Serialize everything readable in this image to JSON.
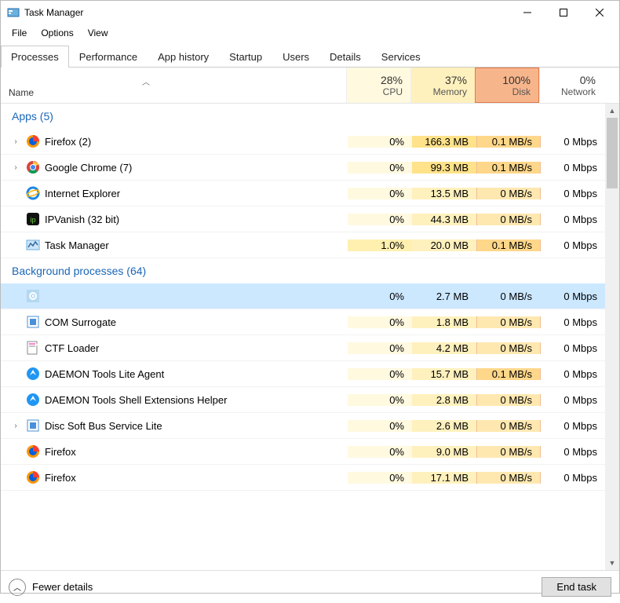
{
  "window": {
    "title": "Task Manager"
  },
  "menu": {
    "file": "File",
    "options": "Options",
    "view": "View"
  },
  "tabs": {
    "processes": "Processes",
    "performance": "Performance",
    "apphistory": "App history",
    "startup": "Startup",
    "users": "Users",
    "details": "Details",
    "services": "Services"
  },
  "columns": {
    "name": "Name",
    "cpu": {
      "pct": "28%",
      "label": "CPU"
    },
    "mem": {
      "pct": "37%",
      "label": "Memory"
    },
    "dsk": {
      "pct": "100%",
      "label": "Disk"
    },
    "net": {
      "pct": "0%",
      "label": "Network"
    }
  },
  "groups": {
    "apps": "Apps (5)",
    "bg": "Background processes (64)"
  },
  "apps": [
    {
      "exp": true,
      "icon": "firefox",
      "name": "Firefox (2)",
      "cpu": "0%",
      "mem": "166.3 MB",
      "dsk": "0.1 MB/s",
      "net": "0 Mbps"
    },
    {
      "exp": true,
      "icon": "chrome",
      "name": "Google Chrome (7)",
      "cpu": "0%",
      "mem": "99.3 MB",
      "dsk": "0.1 MB/s",
      "net": "0 Mbps"
    },
    {
      "exp": false,
      "icon": "ie",
      "name": "Internet Explorer",
      "cpu": "0%",
      "mem": "13.5 MB",
      "dsk": "0 MB/s",
      "net": "0 Mbps"
    },
    {
      "exp": false,
      "icon": "ipv",
      "name": "IPVanish (32 bit)",
      "cpu": "0%",
      "mem": "44.3 MB",
      "dsk": "0 MB/s",
      "net": "0 Mbps"
    },
    {
      "exp": false,
      "icon": "tm",
      "name": "Task Manager",
      "cpu": "1.0%",
      "mem": "20.0 MB",
      "dsk": "0.1 MB/s",
      "net": "0 Mbps"
    }
  ],
  "bg": [
    {
      "exp": false,
      "icon": "gear",
      "name": "",
      "cpu": "0%",
      "mem": "2.7 MB",
      "dsk": "0 MB/s",
      "net": "0 Mbps",
      "selected": true
    },
    {
      "exp": false,
      "icon": "com",
      "name": "COM Surrogate",
      "cpu": "0%",
      "mem": "1.8 MB",
      "dsk": "0 MB/s",
      "net": "0 Mbps"
    },
    {
      "exp": false,
      "icon": "ctf",
      "name": "CTF Loader",
      "cpu": "0%",
      "mem": "4.2 MB",
      "dsk": "0 MB/s",
      "net": "0 Mbps"
    },
    {
      "exp": false,
      "icon": "daemon",
      "name": "DAEMON Tools Lite Agent",
      "cpu": "0%",
      "mem": "15.7 MB",
      "dsk": "0.1 MB/s",
      "net": "0 Mbps"
    },
    {
      "exp": false,
      "icon": "daemon",
      "name": "DAEMON Tools Shell Extensions Helper",
      "cpu": "0%",
      "mem": "2.8 MB",
      "dsk": "0 MB/s",
      "net": "0 Mbps"
    },
    {
      "exp": true,
      "icon": "com",
      "name": "Disc Soft Bus Service Lite",
      "cpu": "0%",
      "mem": "2.6 MB",
      "dsk": "0 MB/s",
      "net": "0 Mbps"
    },
    {
      "exp": false,
      "icon": "firefox",
      "name": "Firefox",
      "cpu": "0%",
      "mem": "9.0 MB",
      "dsk": "0 MB/s",
      "net": "0 Mbps"
    },
    {
      "exp": false,
      "icon": "firefox",
      "name": "Firefox",
      "cpu": "0%",
      "mem": "17.1 MB",
      "dsk": "0 MB/s",
      "net": "0 Mbps"
    }
  ],
  "footer": {
    "fewer": "Fewer details",
    "end": "End task"
  }
}
